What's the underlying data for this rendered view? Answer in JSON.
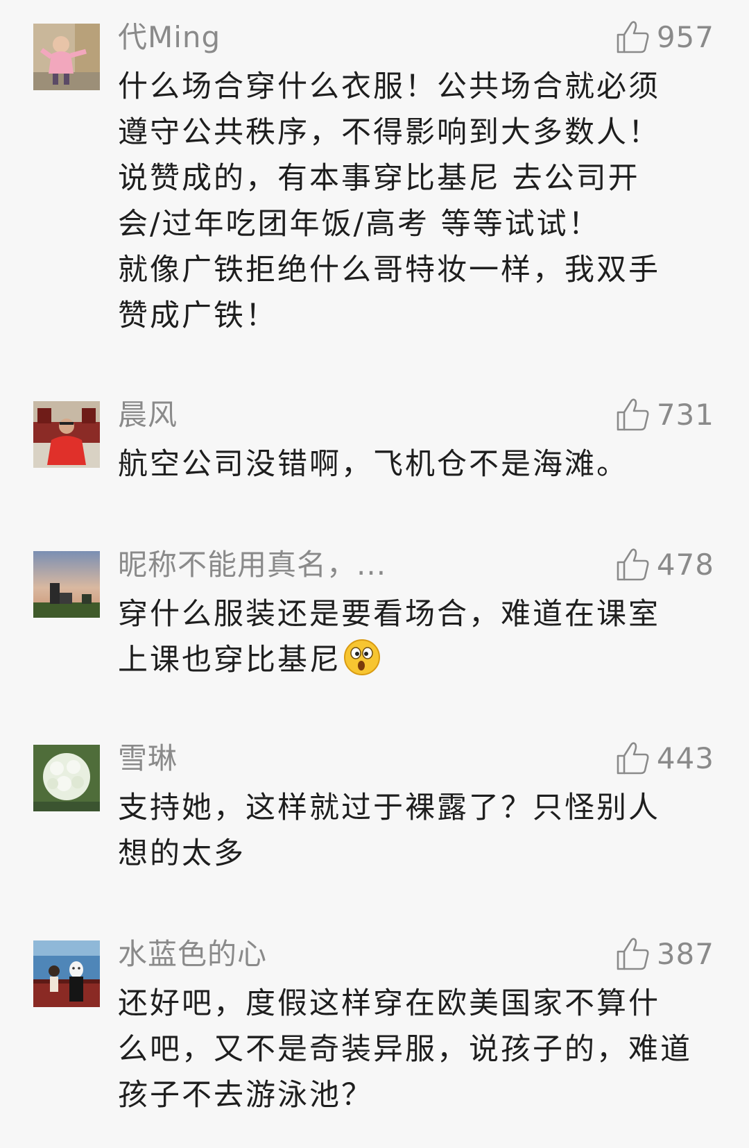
{
  "comments": [
    {
      "nickname": "代Ming",
      "likes": "957",
      "avatar_icon": "avatar-child-pink-icon",
      "text_lines": [
        "什么场合穿什么衣服！公共场合就必须",
        "遵守公共秩序，不得影响到大多数人！",
        "说赞成的，有本事穿比基尼 去公司开",
        "会/过年吃团年饭/高考 等等试试！",
        "就像广铁拒绝什么哥特妆一样，我双手",
        "赞成广铁！"
      ]
    },
    {
      "nickname": "晨风",
      "likes": "731",
      "avatar_icon": "avatar-man-red-jacket-icon",
      "text_lines": [
        "航空公司没错啊，飞机仓不是海滩。"
      ]
    },
    {
      "nickname": "昵称不能用真名，...",
      "likes": "478",
      "avatar_icon": "avatar-sunset-landscape-icon",
      "text_lines": [
        "穿什么服装还是要看场合，难道在课室",
        "上课也穿比基尼"
      ],
      "trailing_emoji": "surprised-face-emoji"
    },
    {
      "nickname": "雪琳",
      "likes": "443",
      "avatar_icon": "avatar-white-hydrangea-icon",
      "text_lines": [
        "支持她，这样就过于裸露了？只怪别人",
        "想的太多"
      ]
    },
    {
      "nickname": "水蓝色的心",
      "likes": "387",
      "avatar_icon": "avatar-anime-scene-icon",
      "text_lines": [
        "还好吧，度假这样穿在欧美国家不算什",
        "么吧，又不是奇装异服，说孩子的，难道",
        "孩子不去游泳池？"
      ]
    }
  ],
  "colors": {
    "background": "#f7f7f7",
    "meta_text": "#8a8a8a",
    "body_text": "#1e1e1e"
  }
}
